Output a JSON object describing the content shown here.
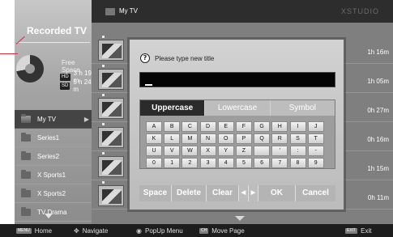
{
  "header": {
    "title": "My TV",
    "brand": "XSTUDIO"
  },
  "left": {
    "title": "Recorded TV",
    "free_space_label": "Free Space",
    "quality": [
      {
        "badge": "HD",
        "time": "3 h 19 m"
      },
      {
        "badge": "SD",
        "time": "5 h 24 m"
      }
    ],
    "nav": [
      {
        "label": "My TV",
        "active": true
      },
      {
        "label": "Series1"
      },
      {
        "label": "Series2"
      },
      {
        "label": "X Sports1"
      },
      {
        "label": "X Sports2"
      },
      {
        "label": "TV Drama"
      }
    ]
  },
  "recordings": [
    {
      "duration": "1h 16m"
    },
    {
      "duration": "1h 05m"
    },
    {
      "duration": "0h 27m"
    },
    {
      "duration": "0h 16m"
    },
    {
      "duration": "1h 15m"
    },
    {
      "duration": "0h 11m"
    }
  ],
  "dialog": {
    "prompt": "Please type new title",
    "input_value": "",
    "modes": [
      "Uppercase",
      "Lowercase",
      "Symbol"
    ],
    "active_mode": "Uppercase",
    "keys": [
      [
        "A",
        "B",
        "C",
        "D",
        "E",
        "F",
        "G",
        "H",
        "I",
        "J"
      ],
      [
        "K",
        "L",
        "M",
        "N",
        "O",
        "P",
        "Q",
        "R",
        "S",
        "T"
      ],
      [
        "U",
        "V",
        "W",
        "X",
        "Y",
        "Z",
        "",
        "'",
        ":",
        "-"
      ],
      [
        "0",
        "1",
        "2",
        "3",
        "4",
        "5",
        "6",
        "7",
        "8",
        "9"
      ]
    ],
    "actions": {
      "space": "Space",
      "delete": "Delete",
      "clear": "Clear",
      "ok": "OK",
      "cancel": "Cancel"
    }
  },
  "footer": {
    "home_badge": "MENU",
    "home": "Home",
    "navigate": "Navigate",
    "popup": "PopUp Menu",
    "ch_badge": "CH",
    "move_page": "Move Page",
    "exit_badge": "EXIT",
    "exit": "Exit"
  }
}
